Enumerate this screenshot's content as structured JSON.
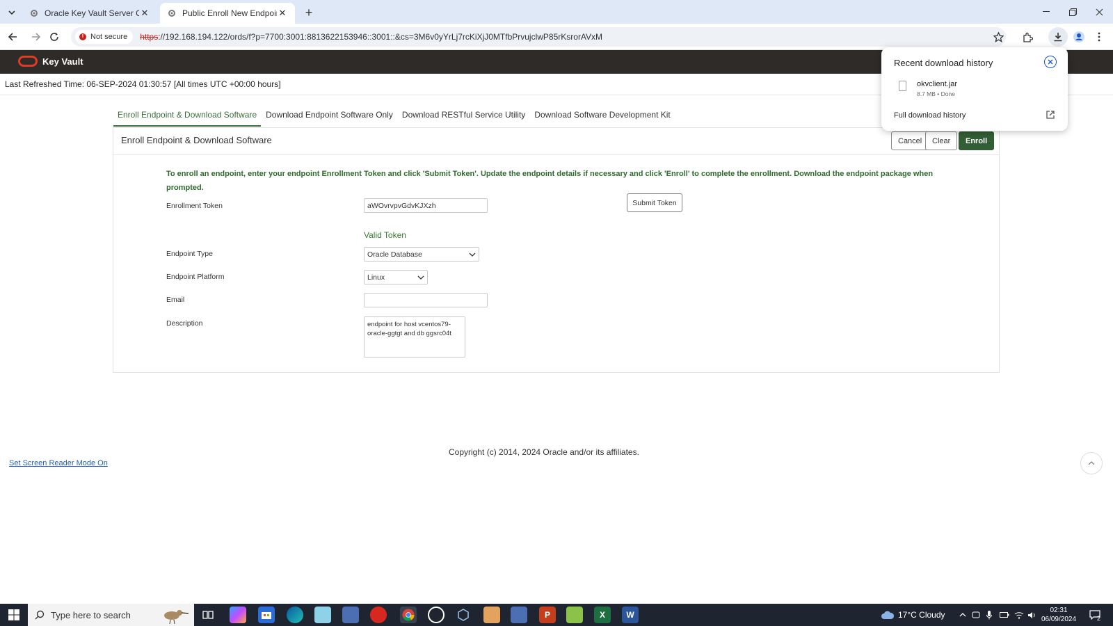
{
  "browser": {
    "tabs": [
      {
        "title": "Oracle Key Vault Server Console",
        "active": false
      },
      {
        "title": "Public Enroll New Endpoint",
        "active": true
      }
    ],
    "security_label": "Not secure",
    "url_scheme": "https",
    "url_rest": "://192.168.194.122/ords/f?p=7700:3001:8813622153946::3001::&cs=3M6v0yYrLj7rcKiXjJ0MTfbPrvujclwP85rKsrorAVxM"
  },
  "app": {
    "name": "Key Vault",
    "last_refreshed": "Last Refreshed Time: 06-SEP-2024 01:30:57 [All times UTC +00:00 hours]"
  },
  "subtabs": [
    {
      "label": "Enroll Endpoint & Download Software",
      "active": true
    },
    {
      "label": "Download Endpoint Software Only",
      "active": false
    },
    {
      "label": "Download RESTful Service Utility",
      "active": false
    },
    {
      "label": "Download Software Development Kit",
      "active": false
    }
  ],
  "region": {
    "title": "Enroll Endpoint & Download Software",
    "buttons": {
      "cancel": "Cancel",
      "clear": "Clear",
      "enroll": "Enroll"
    },
    "instructions": "To enroll an endpoint, enter your endpoint Enrollment Token and click 'Submit Token'. Update the endpoint details if necessary and click 'Enroll' to complete the enrollment. Download the endpoint package when prompted.",
    "submit_token": "Submit Token",
    "valid_token": "Valid Token",
    "fields": {
      "token_label": "Enrollment Token",
      "token_value": "aWOvrvpvGdvKJXzh",
      "type_label": "Endpoint Type",
      "type_value": "Oracle Database",
      "platform_label": "Endpoint Platform",
      "platform_value": "Linux",
      "email_label": "Email",
      "email_value": "",
      "description_label": "Description",
      "description_value": "endpoint for host vcentos79-oracle-ggtgt and db ggsrc04t"
    }
  },
  "footer": {
    "copyright": "Copyright (c) 2014, 2024 Oracle and/or its affiliates.",
    "screen_reader": "Set Screen Reader Mode On"
  },
  "download_popup": {
    "title": "Recent download history",
    "file_name": "okvclient.jar",
    "file_meta": "8.7 MB • Done",
    "full_history": "Full download history"
  },
  "taskbar": {
    "search_placeholder": "Type here to search",
    "weather": "17°C  Cloudy",
    "time": "02:31",
    "date": "06/09/2024",
    "notification_count": "2"
  },
  "colors": {
    "accent_green": "#325e35",
    "oracle_red": "#e03b24",
    "header_dark": "#2f2b28"
  }
}
